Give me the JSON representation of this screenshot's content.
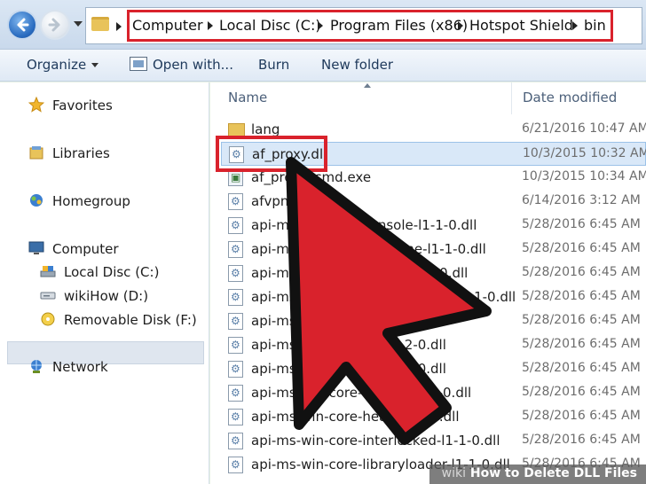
{
  "address_bar": {
    "breadcrumbs": [
      "Computer",
      "Local Disc (C:)",
      "Program Files (x86)",
      "Hotspot Shield",
      "bin"
    ]
  },
  "toolbar": {
    "organize_label": "Organize",
    "open_with_label": "Open with...",
    "burn_label": "Burn",
    "new_folder_label": "New folder"
  },
  "navigation_pane": {
    "favorites": "Favorites",
    "libraries": "Libraries",
    "homegroup": "Homegroup",
    "computer": "Computer",
    "drives": [
      "Local Disc (C:)",
      "wikiHow (D:)",
      "Removable Disk (F:)"
    ],
    "network": "Network"
  },
  "file_list": {
    "columns": [
      "Name",
      "Date modified"
    ],
    "rows": [
      {
        "name": "lang",
        "date": "6/21/2016 10:47 AM",
        "icon": "folder"
      },
      {
        "name": "af_proxy.dll",
        "date": "10/3/2015 10:32 AM",
        "icon": "dll"
      },
      {
        "name": "af_proxy_cmd.exe",
        "date": "10/3/2015 10:34 AM",
        "icon": "exe"
      },
      {
        "name": "afvpn.dll",
        "date": "6/14/2016 3:12 AM",
        "icon": "dll"
      },
      {
        "name": "api-ms-win-core-console-l1-1-0.dll",
        "date": "5/28/2016 6:45 AM",
        "icon": "dll"
      },
      {
        "name": "api-ms-win-core-datetime-l1-1-0.dll",
        "date": "5/28/2016 6:45 AM",
        "icon": "dll"
      },
      {
        "name": "api-ms-win-core-debug-l1-1-0.dll",
        "date": "5/28/2016 6:45 AM",
        "icon": "dll"
      },
      {
        "name": "api-ms-win-core-errorhandling-l1-1-0.dll",
        "date": "5/28/2016 6:45 AM",
        "icon": "dll"
      },
      {
        "name": "api-ms-win-core-file-l1-1-0.dll",
        "date": "5/28/2016 6:45 AM",
        "icon": "dll"
      },
      {
        "name": "api-ms-win-core-file-l1-2-0.dll",
        "date": "5/28/2016 6:45 AM",
        "icon": "dll"
      },
      {
        "name": "api-ms-win-core-file-l2-1-0.dll",
        "date": "5/28/2016 6:45 AM",
        "icon": "dll"
      },
      {
        "name": "api-ms-win-core-handle-l1-1-0.dll",
        "date": "5/28/2016 6:45 AM",
        "icon": "dll"
      },
      {
        "name": "api-ms-win-core-heap-l1-1-0.dll",
        "date": "5/28/2016 6:45 AM",
        "icon": "dll"
      },
      {
        "name": "api-ms-win-core-interlocked-l1-1-0.dll",
        "date": "5/28/2016 6:45 AM",
        "icon": "dll"
      },
      {
        "name": "api-ms-win-core-libraryloader-l1-1-0.dll",
        "date": "5/28/2016 6:45 AM",
        "icon": "dll"
      }
    ]
  },
  "watermark": {
    "brand": "wiki",
    "title": "How to Delete DLL Files"
  },
  "colors": {
    "highlight_red": "#d9222c",
    "selection_blue": "#d9e8f8"
  }
}
